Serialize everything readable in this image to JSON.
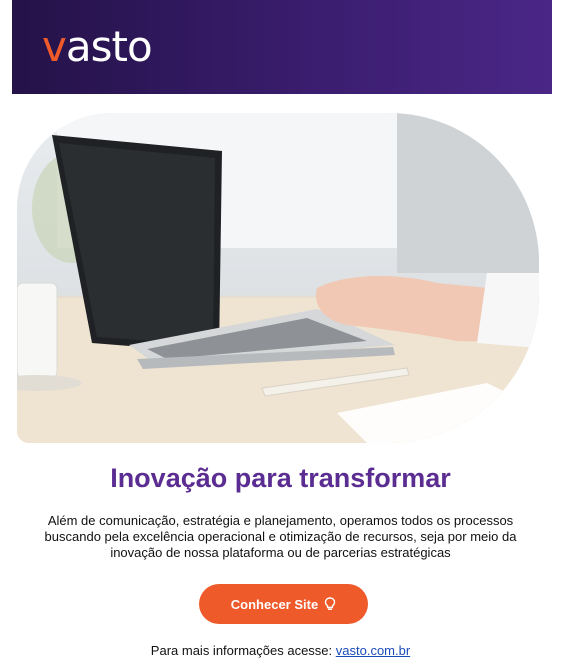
{
  "header": {
    "logo_prefix": "v",
    "logo_rest": "asto"
  },
  "hero": {
    "icon": "laptop-photo"
  },
  "content": {
    "title": "Inovação para transformar",
    "description": "Além de comunicação, estratégia e planejamento, operamos todos os processos buscando pela excelência operacional e otimização de recursos, seja por meio da inovação de nossa plataforma ou de parcerias estratégicas"
  },
  "cta": {
    "label": "Conhecer Site",
    "icon": "lightbulb-icon"
  },
  "footer": {
    "text": "Para mais informações acesse: ",
    "link_label": "vasto.com.br"
  },
  "colors": {
    "brand_purple": "#5b2d92",
    "brand_orange": "#ee5a2a",
    "header_bg": "#3a1d6e"
  }
}
